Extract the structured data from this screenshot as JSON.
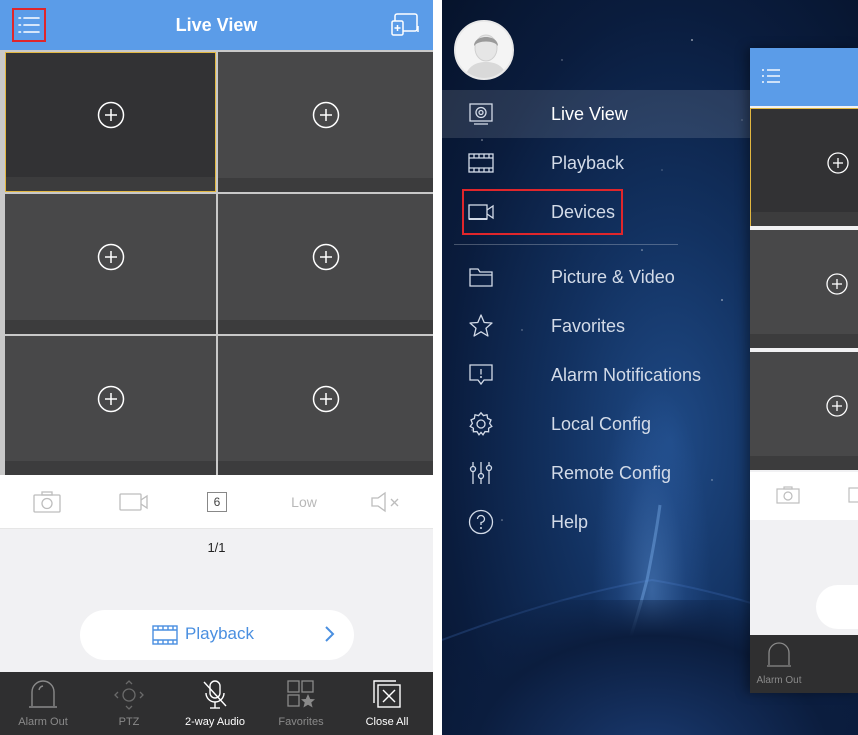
{
  "left_screen": {
    "header": {
      "title": "Live View",
      "menu_icon": "hamburger-menu-icon",
      "cast_icon": "add-screen-icon"
    },
    "grid": {
      "cells": 6,
      "selected_cell": 1,
      "cell_icon": "add-camera-plus-icon"
    },
    "controls": {
      "window_count": "6",
      "quality": "Low"
    },
    "page_indicator": "1/1",
    "playback_button": {
      "label": "Playback"
    },
    "toolbar": [
      {
        "label": "Alarm Out",
        "icon": "alarm-siren-icon",
        "enabled": false
      },
      {
        "label": "PTZ",
        "icon": "ptz-directional-icon",
        "enabled": false
      },
      {
        "label": "2-way Audio",
        "icon": "mic-muted-icon",
        "enabled": true
      },
      {
        "label": "Favorites",
        "icon": "favorites-grid-star-icon",
        "enabled": false
      },
      {
        "label": "Close All",
        "icon": "close-all-icon",
        "enabled": true
      }
    ]
  },
  "right_screen": {
    "menu": [
      {
        "label": "Live View",
        "icon": "monitor-camera-icon",
        "active": true
      },
      {
        "label": "Playback",
        "icon": "film-strip-icon",
        "active": false
      },
      {
        "label": "Devices",
        "icon": "video-camera-icon",
        "active": false,
        "highlighted": true
      },
      {
        "label": "Picture & Video",
        "icon": "folder-icon",
        "active": false
      },
      {
        "label": "Favorites",
        "icon": "star-icon",
        "active": false
      },
      {
        "label": "Alarm Notifications",
        "icon": "alarm-notification-icon",
        "active": false
      },
      {
        "label": "Local Config",
        "icon": "gear-icon",
        "active": false
      },
      {
        "label": "Remote Config",
        "icon": "sliders-icon",
        "active": false
      },
      {
        "label": "Help",
        "icon": "help-circle-icon",
        "active": false
      }
    ],
    "peek_toolbar_label": "Alarm Out"
  },
  "colors": {
    "header_blue": "#5b9ce8",
    "highlight_red": "#e0262b",
    "selected_cell_border": "#e2b740",
    "cell_bg": "#484849",
    "toolbar_bg": "#2f2f30",
    "accent_text": "#4a8fe0"
  }
}
